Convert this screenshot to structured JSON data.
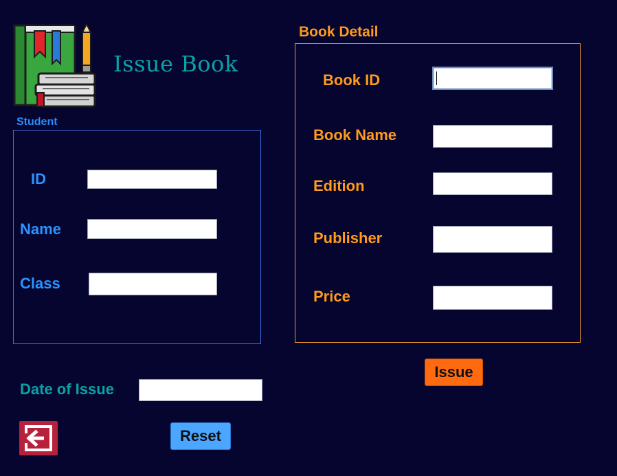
{
  "header": {
    "title": "Issue Book",
    "logo_icon": "books-with-pencil-icon"
  },
  "student": {
    "legend": "Student",
    "id_label": "ID",
    "id_value": "",
    "name_label": "Name",
    "name_value": "",
    "class_label": "Class",
    "class_value": ""
  },
  "book": {
    "legend": "Book Detail",
    "book_id_label": "Book ID",
    "book_id_value": "",
    "book_name_label": "Book Name",
    "book_name_value": "",
    "edition_label": "Edition",
    "edition_value": "",
    "publisher_label": "Publisher",
    "publisher_value": "",
    "price_label": "Price",
    "price_value": ""
  },
  "issue": {
    "date_label": "Date of Issue",
    "date_value": ""
  },
  "buttons": {
    "issue_label": "Issue",
    "reset_label": "Reset",
    "back_icon": "back-arrow-icon"
  },
  "colors": {
    "background": "#050530",
    "title_teal": "#0aa3a3",
    "student_blue": "#2a94ff",
    "book_orange": "#ff9a1a",
    "issue_button": "#ff6a10",
    "reset_button": "#4aa6ff",
    "back_button": "#b8213c"
  }
}
